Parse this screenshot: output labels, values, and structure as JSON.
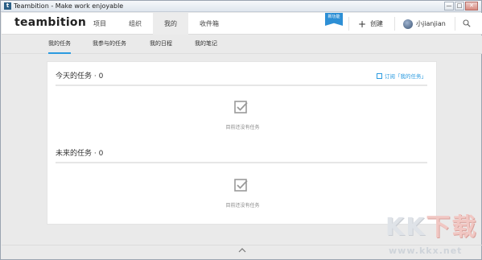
{
  "window": {
    "title": "Teambition - Make work enjoyable",
    "controls": [
      "—",
      "□",
      "✕"
    ]
  },
  "header": {
    "logo": "teambition",
    "nav": [
      {
        "label": "项目"
      },
      {
        "label": "组织"
      },
      {
        "label": "我的"
      },
      {
        "label": "收件箱"
      }
    ],
    "new_badge": "新功能",
    "create_label": "创建",
    "user_name": "小jianjian"
  },
  "subtabs": [
    {
      "label": "我的任务"
    },
    {
      "label": "我参与的任务"
    },
    {
      "label": "我的日程"
    },
    {
      "label": "我的笔记"
    }
  ],
  "main": {
    "today_title": "今天的任务 · 0",
    "subscribe_label": "订阅「我的任务」",
    "today_empty": "目前还没有任务",
    "future_title": "未来的任务 · 0",
    "future_empty": "目前还没有任务"
  },
  "watermark": {
    "text_a": "KK",
    "text_b": "下载",
    "url": "www.kkx.net"
  },
  "colors": {
    "accent": "#2b9be0",
    "badge": "#2d8fd5"
  }
}
